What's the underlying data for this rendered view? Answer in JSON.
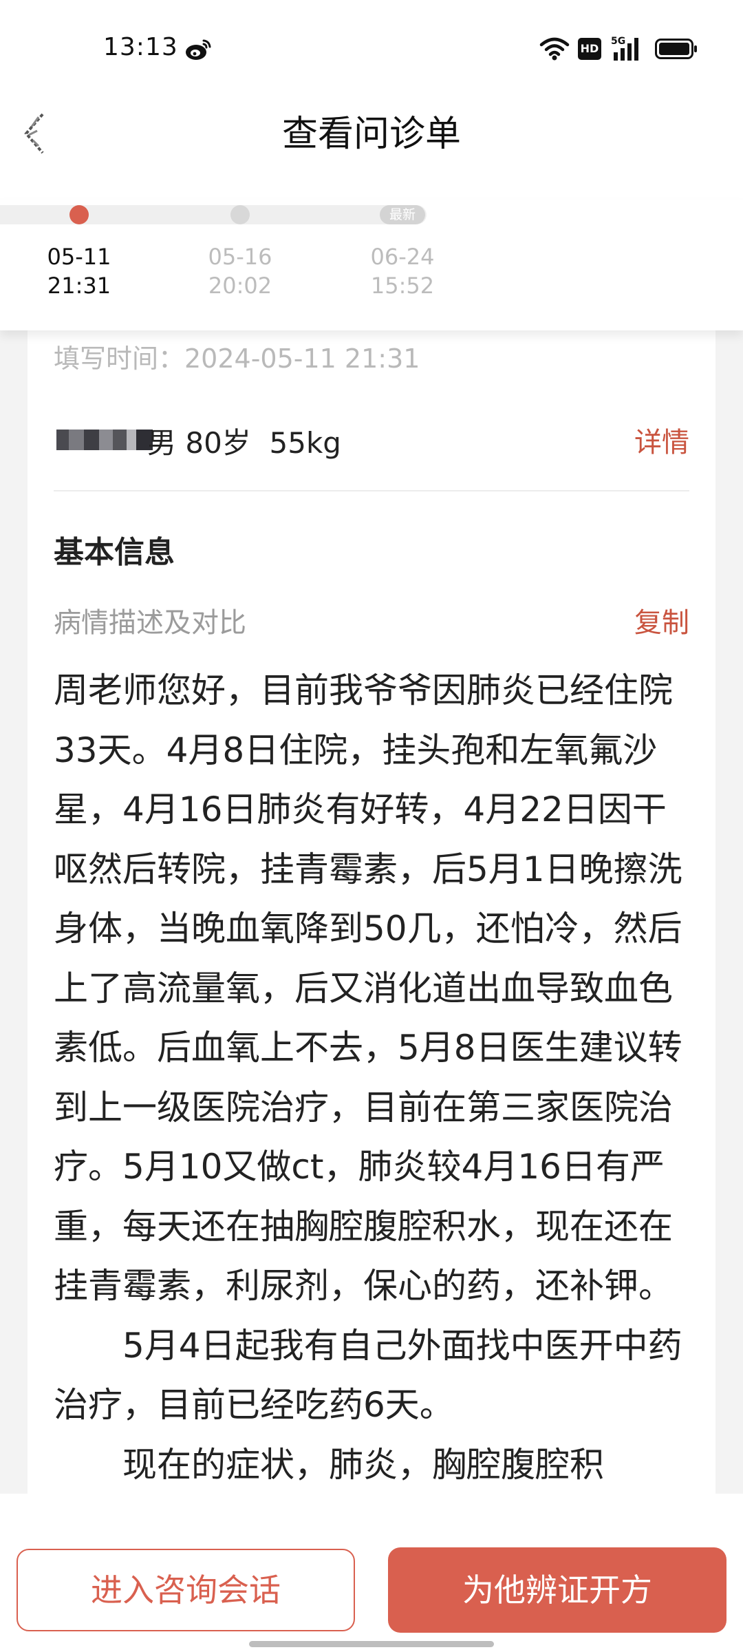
{
  "status_bar": {
    "time": "13:13",
    "weibo_icon": "weibo-icon",
    "wifi_icon": "wifi-icon",
    "hd_label": "HD",
    "network_label": "5G",
    "signal_icon": "signal-icon",
    "battery_icon": "battery-icon"
  },
  "header": {
    "title": "查看问诊单",
    "back_icon": "back-arrow-icon"
  },
  "timeline": {
    "latest_badge": "最新",
    "entries": [
      {
        "date": "05-11",
        "time": "21:31",
        "active": true
      },
      {
        "date": "05-16",
        "time": "20:02",
        "active": false
      },
      {
        "date": "06-24",
        "time": "15:52",
        "active": false
      }
    ]
  },
  "form": {
    "fill_time": "填写时间：2024-05-11 21:31",
    "patient": {
      "info": "男 80岁  55kg",
      "detail_link": "详情"
    },
    "basic_info_title": "基本信息",
    "description_label": "病情描述及对比",
    "copy_link": "复制",
    "description": "周老师您好，目前我爷爷因肺炎已经住院33天。4月8日住院，挂头孢和左氧氟沙星，4月16日肺炎有好转，4月22日因干呕然后转院，挂青霉素，后5月1日晚擦洗身体，当晚血氧降到50几，还怕冷，然后上了高流量氧，后又消化道出血导致血色素低。后血氧上不去，5月8日医生建议转到上一级医院治疗，目前在第三家医院治疗。5月10又做ct，肺炎较4月16日有严重，每天还在抽胸腔腹腔积水，现在还在挂青霉素，利尿剂，保心的药，还补钾。\n　　5月4日起我有自己外面找中医开中药治疗，目前已经吃药6天。\n　　现在的症状，肺炎，胸腔腹腔积"
  },
  "bottom_bar": {
    "consult_button": "进入咨询会话",
    "prescribe_button": "为他辨证开方"
  },
  "colors": {
    "accent": "#d9604f",
    "link": "#c9543f",
    "muted_text": "#b9b9b9",
    "background": "#f3f3f3"
  }
}
